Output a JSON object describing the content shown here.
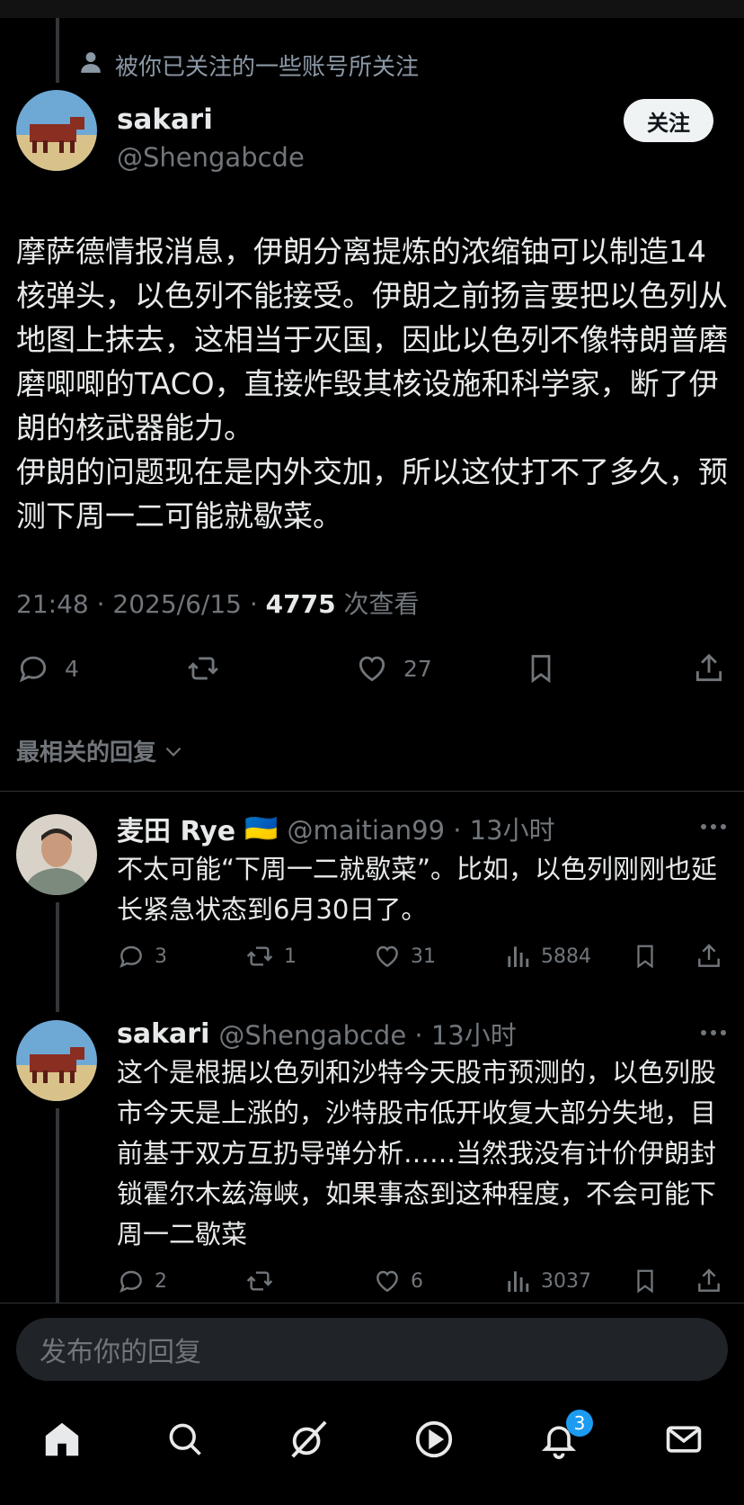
{
  "context": {
    "text": "被你已关注的一些账号所关注",
    "icon": "person-icon"
  },
  "post": {
    "name": "sakari",
    "handle": "@Shengabcde",
    "follow_label": "关注",
    "text": "摩萨德情报消息，伊朗分离提炼的浓缩铀可以制造14核弹头，以色列不能接受。伊朗之前扬言要把以色列从地图上抹去，这相当于灭国，因此以色列不像特朗普磨磨唧唧的TACO，直接炸毁其核设施和科学家，断了伊朗的核武器能力。\n伊朗的问题现在是内外交加，所以这仗打不了多久，预测下周一二可能就歇菜。",
    "time": "21:48 · 2025/6/15 · ",
    "views": "4775",
    "views_label": " 次查看",
    "actions": {
      "replies": "4",
      "likes": "27"
    }
  },
  "sort_label": "最相关的回复",
  "replies": [
    {
      "name": "麦田 Rye",
      "flag": "🇺🇦",
      "handle": "@maitian99 · 13小时",
      "text": "不太可能“下周一二就歇菜”。比如，以色列刚刚也延长紧急状态到6月30日了。",
      "counts": {
        "replies": "3",
        "reposts": "1",
        "likes": "31",
        "views": "5884"
      }
    },
    {
      "name": "sakari",
      "handle": "@Shengabcde · 13小时",
      "text": "这个是根据以色列和沙特今天股市预测的，以色列股市今天是上涨的，沙特股市低开收复大部分失地，目前基于双方互扔导弹分析……当然我没有计价伊朗封锁霍尔木兹海峡，如果事态到这种程度，不会可能下周一二歇菜",
      "counts": {
        "replies": "2",
        "reposts": "",
        "likes": "6",
        "views": "3037"
      }
    }
  ],
  "reply_placeholder": "发布你的回复",
  "nav": {
    "items": [
      "home-icon",
      "search-icon",
      "grok-icon",
      "video-icon",
      "notifications-icon",
      "messages-icon"
    ],
    "notification_badge": "3"
  },
  "colors": {
    "accent": "#1d9bf0",
    "muted": "#71767b",
    "text": "#e7e9ea",
    "background": "#000000"
  }
}
